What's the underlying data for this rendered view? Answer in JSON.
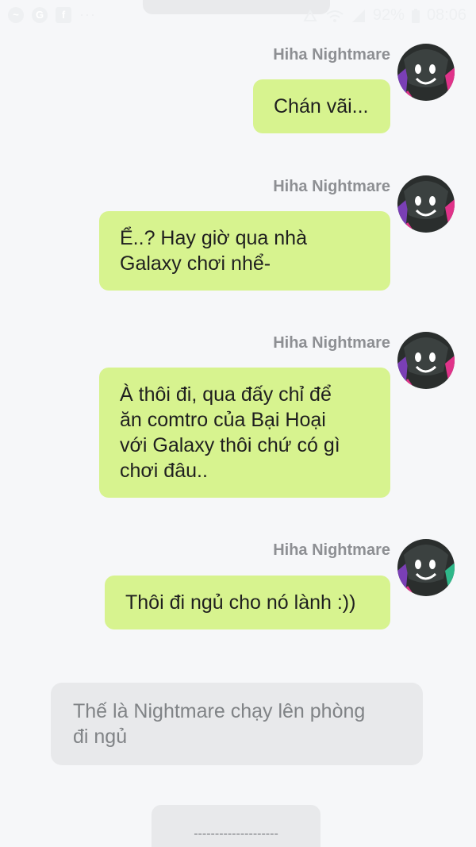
{
  "status_bar": {
    "left_icons": [
      "messenger-icon",
      "google-icon",
      "facebook-icon"
    ],
    "more": "···",
    "battery": "92%",
    "time": "08:06"
  },
  "messages": [
    {
      "sender": "Hiha Nightmare",
      "text": "Chán vãi..."
    },
    {
      "sender": "Hiha Nightmare",
      "text": "Ể..? Hay giờ qua nhà\nGalaxy chơi nhể-"
    },
    {
      "sender": "Hiha Nightmare",
      "text": "À thôi đi, qua đấy chỉ để\năn comtro của Bại Hoại\nvới Galaxy thôi chứ có gì\nchơi đâu.."
    },
    {
      "sender": "Hiha Nightmare",
      "text": "Thôi đi ngủ cho nó lành :))"
    }
  ],
  "system_message": "Thế là Nightmare chạy lên phòng\nđi ngủ",
  "bottom_card": "--------------------",
  "colors": {
    "background": "#f6f7f9",
    "bubble": "#d7f38f",
    "system_bubble": "#e8e9eb",
    "sender_text": "#8d8f93"
  }
}
